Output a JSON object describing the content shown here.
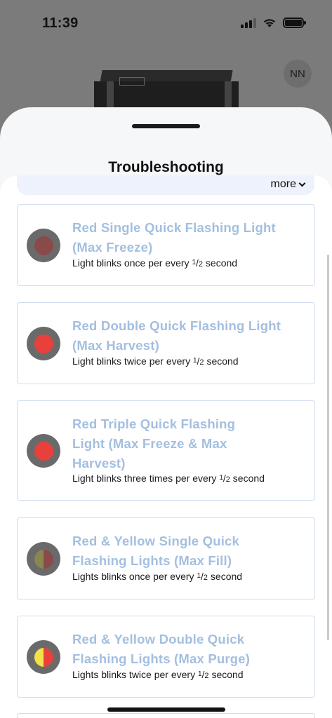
{
  "status_bar": {
    "time": "11:39"
  },
  "background": {
    "avatar_initials": "NN"
  },
  "sheet": {
    "title": "Troubleshooting",
    "more_label": "more"
  },
  "colors": {
    "title_blue": "#a3bfe0",
    "card_border": "#d1dcf0",
    "indicator_bg": "#6a6a6a",
    "red": "#e8413b",
    "dim_red": "#8a4a4a",
    "yellow": "#f1e24a",
    "dim_yellow": "#8a8651"
  },
  "cards": [
    {
      "title": "Red Single Quick Flashing Light (Max Freeze)",
      "desc_prefix": "Light blinks once per every",
      "frac_n": "1",
      "frac_d": "2",
      "desc_suffix": "second",
      "indicator": "red-dim-icon"
    },
    {
      "title": "Red Double Quick Flashing Light (Max Harvest)",
      "desc_prefix": "Light blinks twice per every",
      "frac_n": "1",
      "frac_d": "2",
      "desc_suffix": "second",
      "indicator": "red-icon"
    },
    {
      "title": "Red Triple Quick Flashing Light (Max Freeze & Max Harvest)",
      "desc_prefix": "Light blinks three times per every",
      "frac_n": "1",
      "frac_d": "2",
      "desc_suffix": "second",
      "indicator": "red-icon"
    },
    {
      "title": "Red & Yellow Single Quick Flashing Lights (Max Fill)",
      "desc_prefix": "Lights blinks once per every",
      "frac_n": "1",
      "frac_d": "2",
      "desc_suffix": "second",
      "indicator": "yellow-red-dim-icon"
    },
    {
      "title": "Red & Yellow Double Quick Flashing Lights (Max Purge)",
      "desc_prefix": "Lights blinks twice per every",
      "frac_n": "1",
      "frac_d": "2",
      "desc_suffix": "second",
      "indicator": "yellow-red-icon"
    }
  ]
}
